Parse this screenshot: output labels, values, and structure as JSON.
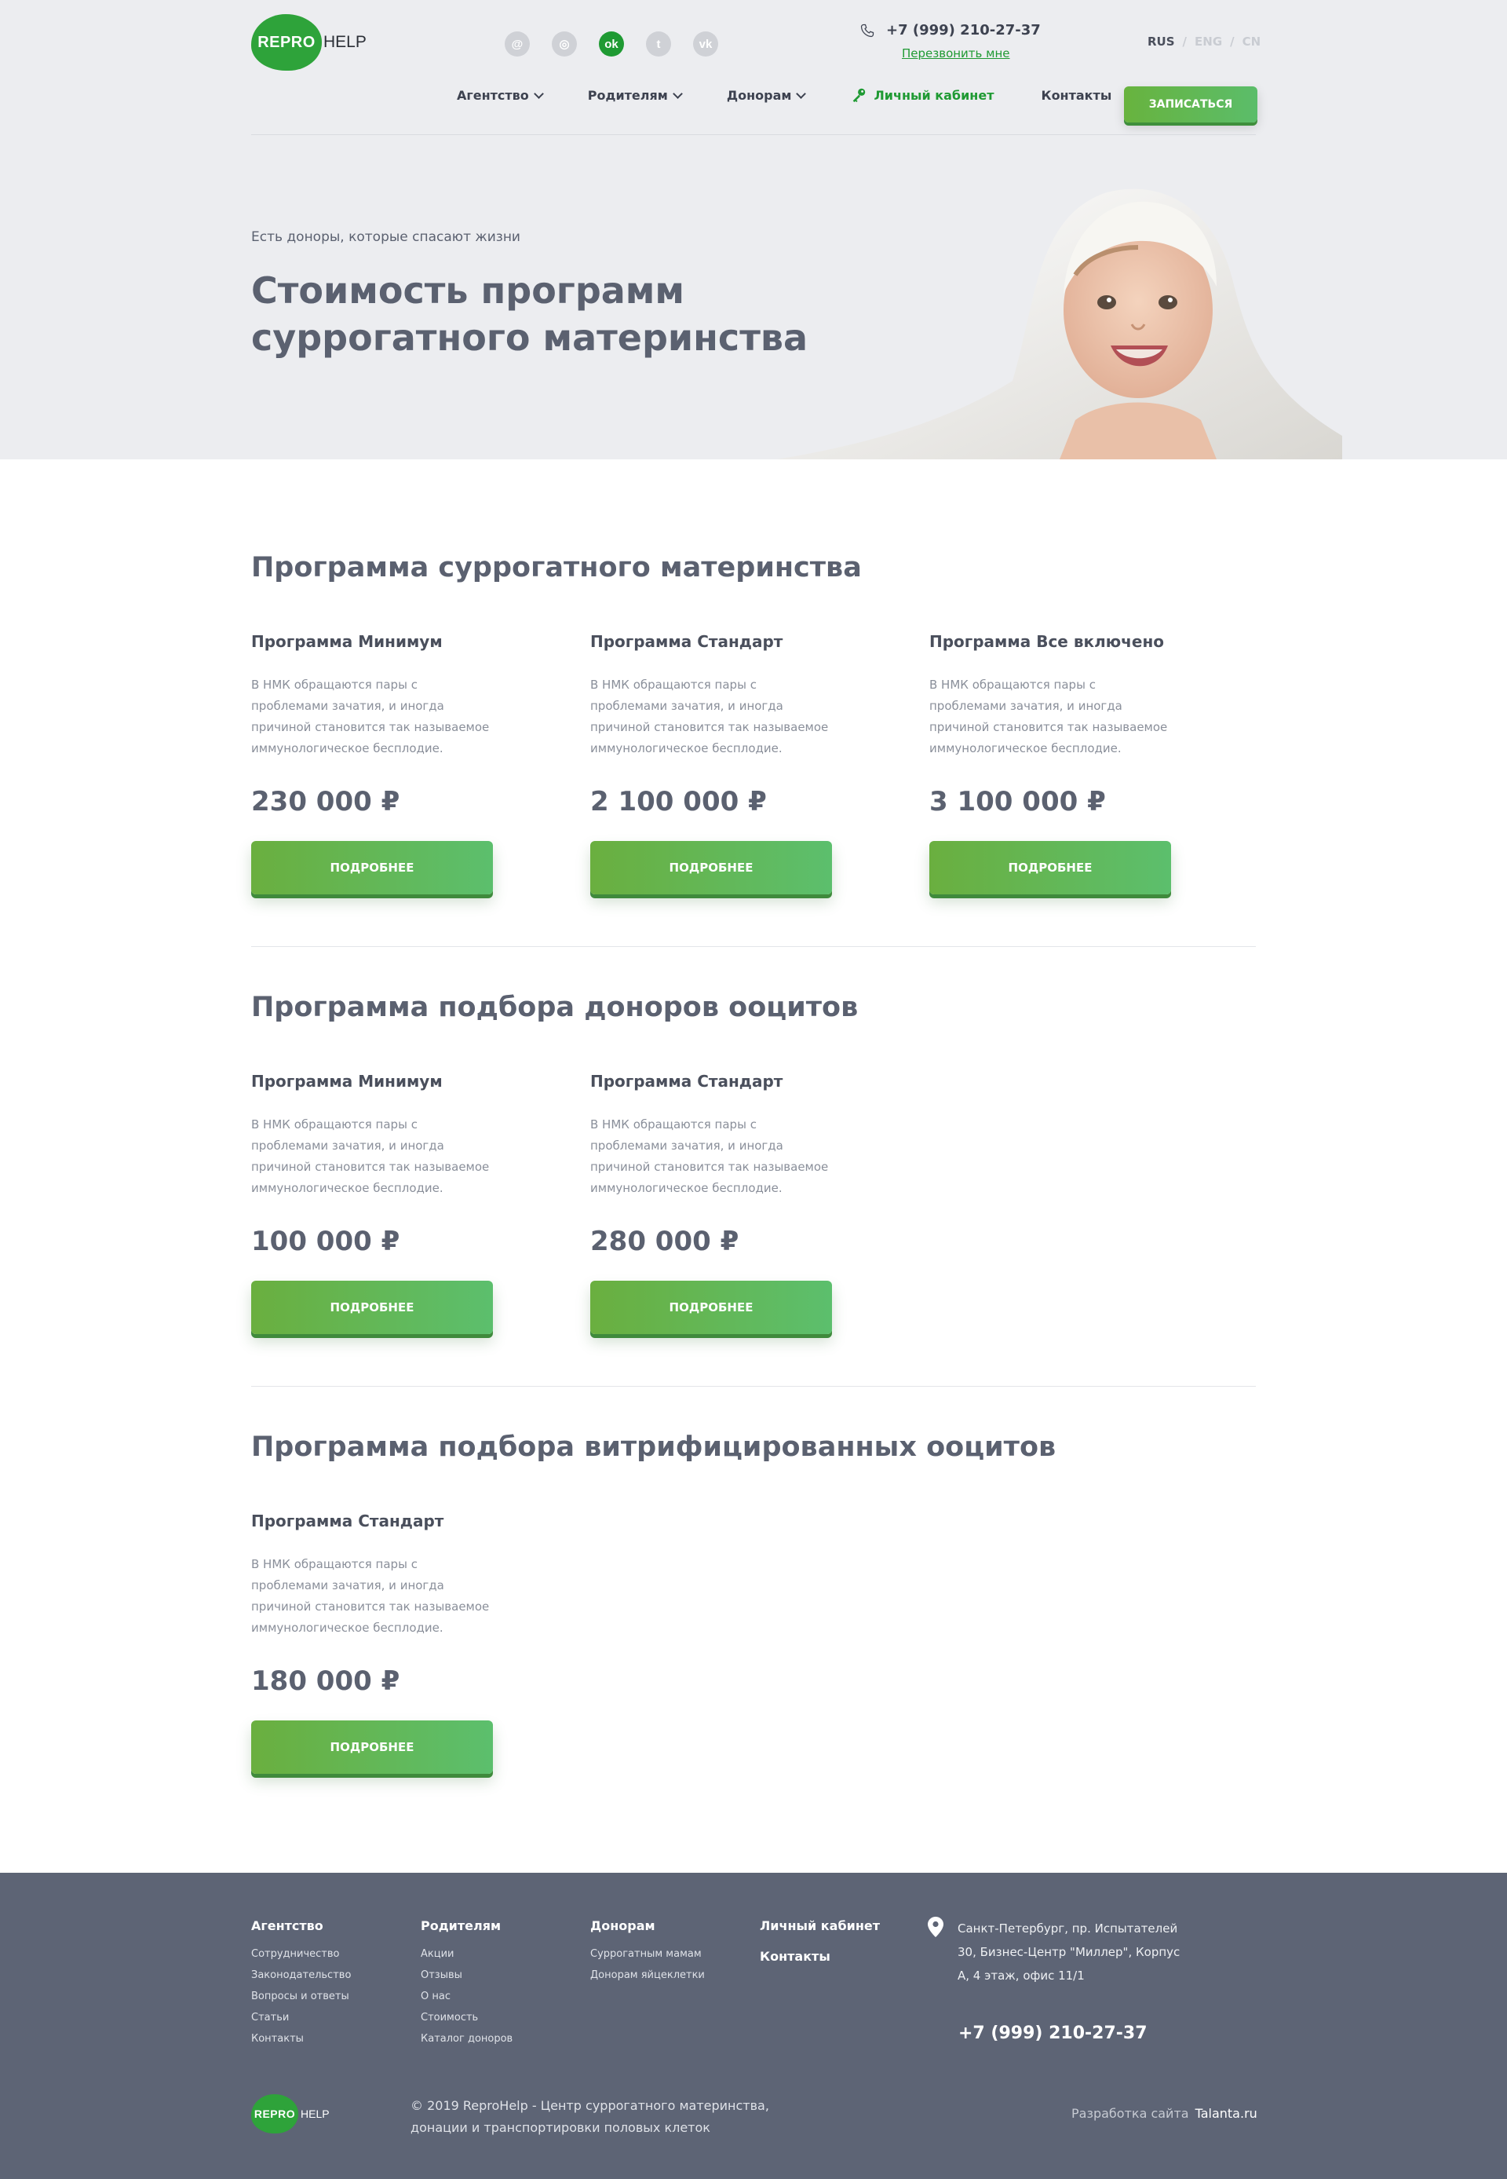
{
  "header": {
    "logo_repro": "REPRO",
    "logo_help": "HELP",
    "social": [
      {
        "icon": "at-icon",
        "glyph": "@"
      },
      {
        "icon": "instagram-icon",
        "glyph": "◎"
      },
      {
        "icon": "odnoklassniki-icon",
        "glyph": "ok"
      },
      {
        "icon": "twitter-icon",
        "glyph": "t"
      },
      {
        "icon": "vk-icon",
        "glyph": "vk"
      }
    ],
    "phone": "+7 (999) 210-27-37",
    "callback": "Перезвонить мне",
    "langs": [
      "RUS",
      "/",
      "ENG",
      "/",
      "CN"
    ],
    "nav": {
      "agency": "Агентство",
      "parents": "Родителям",
      "donors": "Донорам",
      "cabinet": "Личный кабинет",
      "contacts": "Контакты"
    },
    "signup": "ЗАПИСАТЬСЯ"
  },
  "hero": {
    "subtitle": "Есть доноры, которые спасают жизни",
    "title": "Стоимость программ суррогатного материнства"
  },
  "sections": [
    {
      "title": "Программа суррогатного материнства",
      "cards": [
        {
          "title": "Программа Минимум",
          "desc": "В НМК обращаются пары с проблемами зачатия, и иногда причиной становится так называемое иммунологическое бесплодие.",
          "price": "230 000 ₽",
          "button": "ПОДРОБНЕЕ"
        },
        {
          "title": "Программа Стандарт",
          "desc": "В НМК обращаются пары с проблемами зачатия, и иногда причиной становится так называемое иммунологическое бесплодие.",
          "price": "2 100 000 ₽",
          "button": "ПОДРОБНЕЕ"
        },
        {
          "title": "Программа Все включено",
          "desc": "В НМК обращаются пары с проблемами зачатия, и иногда причиной становится так называемое иммунологическое бесплодие.",
          "price": "3 100 000 ₽",
          "button": "ПОДРОБНЕЕ"
        }
      ]
    },
    {
      "title": "Программа подбора доноров ооцитов",
      "cards": [
        {
          "title": "Программа Минимум",
          "desc": "В НМК обращаются пары с проблемами зачатия, и иногда причиной становится так называемое иммунологическое бесплодие.",
          "price": "100 000 ₽",
          "button": "ПОДРОБНЕЕ"
        },
        {
          "title": "Программа Стандарт",
          "desc": "В НМК обращаются пары с проблемами зачатия, и иногда причиной становится так называемое иммунологическое бесплодие.",
          "price": "280 000 ₽",
          "button": "ПОДРОБНЕЕ"
        }
      ]
    },
    {
      "title": "Программа подбора витрифицированных ооцитов",
      "cards": [
        {
          "title": "Программа Стандарт",
          "desc": "В НМК обращаются пары с проблемами зачатия, и иногда причиной становится так называемое иммунологическое бесплодие.",
          "price": "180 000 ₽",
          "button": "ПОДРОБНЕЕ"
        }
      ]
    }
  ],
  "footer": {
    "columns": [
      {
        "head": "Агентство",
        "links": [
          "Сотрудничество",
          "Законодательство",
          "Вопросы и ответы",
          "Статьи",
          "Контакты"
        ]
      },
      {
        "head": "Родителям",
        "links": [
          "Акции",
          "Отзывы",
          "О нас",
          "Стоимость",
          "Каталог доноров"
        ]
      },
      {
        "head": "Донорам",
        "links": [
          "Суррогатным мамам",
          "Донорам яйцеклетки"
        ]
      }
    ],
    "cabinet": "Личный кабинет",
    "contacts": "Контакты",
    "address": "Санкт-Петербург, пр. Испытателей 30, Бизнес-Центр \"Миллер\", Корпус А, 4 этаж, офис 11/1",
    "phone": "+7 (999) 210-27-37",
    "copyright": "© 2019 ReproHelp - Центр суррогатного материнства, донации и транспортировки половых клеток",
    "dev_label": "Разработка сайта",
    "dev_name": "Talanta.ru"
  },
  "colors": {
    "brand_green": "#1f9a33",
    "button_green": "#62b54f",
    "text_gray": "#5b6170",
    "footer_bg": "#5d6475"
  }
}
